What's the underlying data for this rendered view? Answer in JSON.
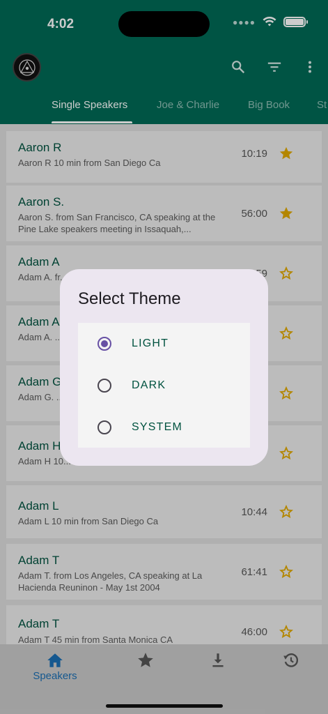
{
  "status_bar": {
    "time": "4:02"
  },
  "app_bar": {
    "tabs": [
      {
        "label": "Single Speakers",
        "active": true
      },
      {
        "label": "Joe & Charlie",
        "active": false
      },
      {
        "label": "Big Book",
        "active": false
      },
      {
        "label": "St",
        "active": false
      }
    ],
    "actions": [
      "search-icon",
      "filter-icon",
      "more-vert-icon"
    ]
  },
  "speakers": [
    {
      "name": "Aaron R",
      "description": "Aaron R 10 min from San Diego Ca",
      "duration": "10:19",
      "favorite": true
    },
    {
      "name": "Aaron S.",
      "description": "Aaron S. from San Francisco, CA speaking at the Pine Lake speakers meeting in Issaquah,...",
      "duration": "56:00",
      "favorite": true
    },
    {
      "name": "Adam A",
      "description": "Adam A. fr... Conyers,...",
      "duration": "...59",
      "favorite": false
    },
    {
      "name": "Adam A",
      "description": "Adam A. ... This Mess...",
      "duration": "",
      "favorite": false
    },
    {
      "name": "Adam G",
      "description": "Adam G. ... topic of R...",
      "duration": "",
      "favorite": false
    },
    {
      "name": "Adam H",
      "description": "Adam H 10...",
      "duration": "",
      "favorite": false
    },
    {
      "name": "Adam L",
      "description": "Adam L 10 min from San Diego Ca",
      "duration": "10:44",
      "favorite": false
    },
    {
      "name": "Adam T",
      "description": "Adam T. from Los Angeles, CA speaking at La Hacienda Reuninon - May 1st 2004",
      "duration": "61:41",
      "favorite": false
    },
    {
      "name": "Adam T",
      "description": "Adam T 45 min from Santa Monica CA",
      "duration": "46:00",
      "favorite": false
    }
  ],
  "dialog": {
    "title": "Select Theme",
    "options": [
      {
        "label": "LIGHT",
        "selected": true
      },
      {
        "label": "DARK",
        "selected": false
      },
      {
        "label": "SYSTEM",
        "selected": false
      }
    ]
  },
  "bottom_nav": {
    "items": [
      {
        "icon": "home-icon",
        "label": "Speakers",
        "active": true
      },
      {
        "icon": "star-icon",
        "label": "",
        "active": false
      },
      {
        "icon": "download-icon",
        "label": "",
        "active": false
      },
      {
        "icon": "history-icon",
        "label": "",
        "active": false
      }
    ]
  },
  "colors": {
    "app_bar": "#006a56",
    "accent": "#6750a4",
    "star": "#e0a800",
    "nav_active": "#1b6fb3"
  }
}
